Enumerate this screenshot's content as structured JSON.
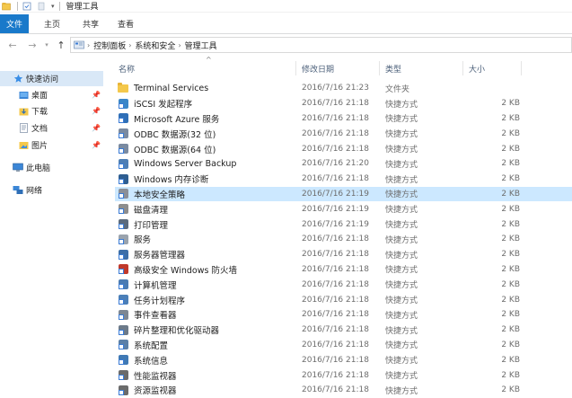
{
  "window": {
    "title": "管理工具"
  },
  "ribbon": {
    "tabs": [
      "文件",
      "主页",
      "共享",
      "查看"
    ]
  },
  "address": {
    "segments": [
      "控制面板",
      "系统和安全",
      "管理工具"
    ]
  },
  "nav": {
    "items": [
      {
        "label": "快速访问",
        "icon": "star-icon"
      },
      {
        "label": "桌面",
        "icon": "desktop-folder-icon",
        "pinned": true
      },
      {
        "label": "下载",
        "icon": "download-folder-icon",
        "pinned": true
      },
      {
        "label": "文档",
        "icon": "documents-folder-icon",
        "pinned": true
      },
      {
        "label": "图片",
        "icon": "pictures-folder-icon",
        "pinned": true
      },
      {
        "label": "此电脑",
        "icon": "computer-icon"
      },
      {
        "label": "网络",
        "icon": "network-icon"
      }
    ]
  },
  "columns": {
    "name": "名称",
    "date": "修改日期",
    "type": "类型",
    "size": "大小"
  },
  "files": [
    {
      "name": "Terminal Services",
      "date": "2016/7/16 21:23",
      "type": "文件夹",
      "size": "",
      "icon": "folder-icon",
      "color": "#f4c84b"
    },
    {
      "name": "iSCSI 发起程序",
      "date": "2016/7/16 21:18",
      "type": "快捷方式",
      "size": "2 KB",
      "icon": "iscsi-icon",
      "color": "#3a86c8"
    },
    {
      "name": "Microsoft Azure 服务",
      "date": "2016/7/16 21:18",
      "type": "快捷方式",
      "size": "2 KB",
      "icon": "azure-icon",
      "color": "#2f6fb7"
    },
    {
      "name": "ODBC 数据源(32 位)",
      "date": "2016/7/16 21:18",
      "type": "快捷方式",
      "size": "2 KB",
      "icon": "odbc-icon",
      "color": "#7a8aa0"
    },
    {
      "name": "ODBC 数据源(64 位)",
      "date": "2016/7/16 21:18",
      "type": "快捷方式",
      "size": "2 KB",
      "icon": "odbc-icon",
      "color": "#7a8aa0"
    },
    {
      "name": "Windows Server Backup",
      "date": "2016/7/16 21:20",
      "type": "快捷方式",
      "size": "2 KB",
      "icon": "backup-icon",
      "color": "#4d7eb5"
    },
    {
      "name": "Windows 内存诊断",
      "date": "2016/7/16 21:18",
      "type": "快捷方式",
      "size": "2 KB",
      "icon": "memory-diagnostic-icon",
      "color": "#2e5e91"
    },
    {
      "name": "本地安全策略",
      "date": "2016/7/16 21:19",
      "type": "快捷方式",
      "size": "2 KB",
      "icon": "security-policy-icon",
      "color": "#8a8f98",
      "selected": true
    },
    {
      "name": "磁盘清理",
      "date": "2016/7/16 21:19",
      "type": "快捷方式",
      "size": "2 KB",
      "icon": "disk-cleanup-icon",
      "color": "#8d8d8d"
    },
    {
      "name": "打印管理",
      "date": "2016/7/16 21:19",
      "type": "快捷方式",
      "size": "2 KB",
      "icon": "printer-icon",
      "color": "#5b6b7d"
    },
    {
      "name": "服务",
      "date": "2016/7/16 21:18",
      "type": "快捷方式",
      "size": "2 KB",
      "icon": "services-icon",
      "color": "#9aa3ad"
    },
    {
      "name": "服务器管理器",
      "date": "2016/7/16 21:18",
      "type": "快捷方式",
      "size": "2 KB",
      "icon": "server-manager-icon",
      "color": "#3c6ea8"
    },
    {
      "name": "高级安全 Windows 防火墙",
      "date": "2016/7/16 21:18",
      "type": "快捷方式",
      "size": "2 KB",
      "icon": "firewall-icon",
      "color": "#c0392b"
    },
    {
      "name": "计算机管理",
      "date": "2016/7/16 21:18",
      "type": "快捷方式",
      "size": "2 KB",
      "icon": "computer-management-icon",
      "color": "#4a7bb3"
    },
    {
      "name": "任务计划程序",
      "date": "2016/7/16 21:18",
      "type": "快捷方式",
      "size": "2 KB",
      "icon": "task-scheduler-icon",
      "color": "#4b7fb8"
    },
    {
      "name": "事件查看器",
      "date": "2016/7/16 21:18",
      "type": "快捷方式",
      "size": "2 KB",
      "icon": "event-viewer-icon",
      "color": "#7d8793"
    },
    {
      "name": "碎片整理和优化驱动器",
      "date": "2016/7/16 21:18",
      "type": "快捷方式",
      "size": "2 KB",
      "icon": "defrag-icon",
      "color": "#6c7a89"
    },
    {
      "name": "系统配置",
      "date": "2016/7/16 21:18",
      "type": "快捷方式",
      "size": "2 KB",
      "icon": "system-config-icon",
      "color": "#5a7fa8"
    },
    {
      "name": "系统信息",
      "date": "2016/7/16 21:18",
      "type": "快捷方式",
      "size": "2 KB",
      "icon": "system-info-icon",
      "color": "#3f79b5"
    },
    {
      "name": "性能监视器",
      "date": "2016/7/16 21:18",
      "type": "快捷方式",
      "size": "2 KB",
      "icon": "performance-monitor-icon",
      "color": "#6b6b6b"
    },
    {
      "name": "资源监视器",
      "date": "2016/7/16 21:18",
      "type": "快捷方式",
      "size": "2 KB",
      "icon": "resource-monitor-icon",
      "color": "#6b6b6b"
    }
  ]
}
